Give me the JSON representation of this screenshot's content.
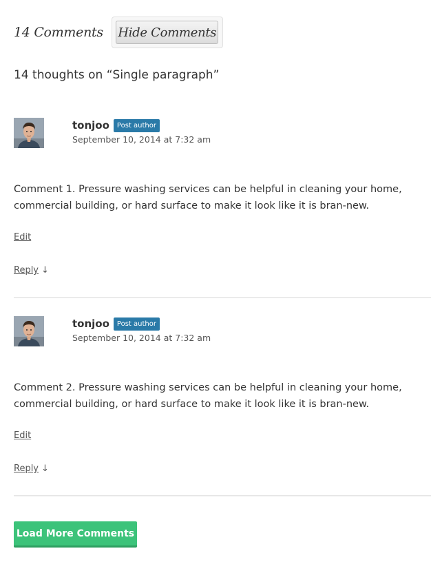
{
  "header": {
    "count_label": "14 Comments",
    "hide_button_label": "Hide Comments"
  },
  "title": "14 thoughts on “Single paragraph”",
  "comments": [
    {
      "author": "tonjoo",
      "badge": "Post author",
      "date": "September 10, 2014 at 7:32 am",
      "text": "Comment 1. Pressure washing services can be helpful in cleaning your home, commercial building, or hard surface to make it look like it is bran-new.",
      "edit_label": "Edit",
      "reply_label": "Reply",
      "reply_arrow": "↓"
    },
    {
      "author": "tonjoo",
      "badge": "Post author",
      "date": "September 10, 2014 at 7:32 am",
      "text": "Comment 2. Pressure washing services can be helpful in cleaning your home, commercial building, or hard surface to make it look like it is bran-new.",
      "edit_label": "Edit",
      "reply_label": "Reply",
      "reply_arrow": "↓"
    }
  ],
  "load_more_label": "Load More Comments",
  "colors": {
    "badge": "#2a7aa8",
    "load_more": "#3cc37a",
    "text": "#333333"
  }
}
